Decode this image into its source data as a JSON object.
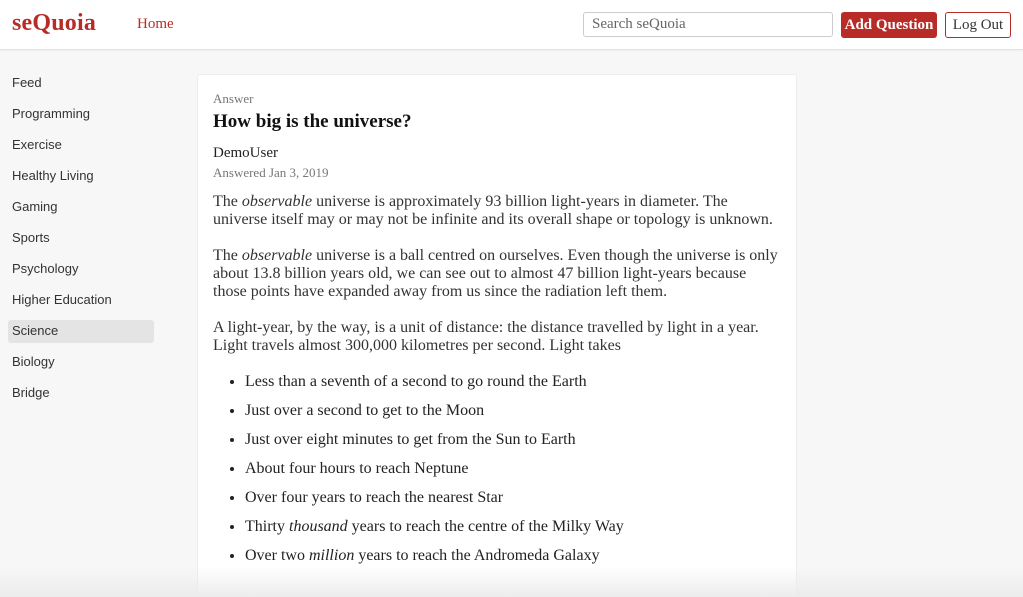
{
  "header": {
    "logo": "seQuoia",
    "home_link": "Home",
    "search_placeholder": "Search seQuoia",
    "add_question_label": "Add Question",
    "logout_label": "Log Out"
  },
  "sidebar": {
    "items": [
      {
        "label": "Feed",
        "active": false
      },
      {
        "label": "Programming",
        "active": false
      },
      {
        "label": "Exercise",
        "active": false
      },
      {
        "label": "Healthy Living",
        "active": false
      },
      {
        "label": "Gaming",
        "active": false
      },
      {
        "label": "Sports",
        "active": false
      },
      {
        "label": "Psychology",
        "active": false
      },
      {
        "label": "Higher Education",
        "active": false
      },
      {
        "label": "Science",
        "active": true
      },
      {
        "label": "Biology",
        "active": false
      },
      {
        "label": "Bridge",
        "active": false
      }
    ]
  },
  "answer": {
    "label": "Answer",
    "question_title": "How big is the universe?",
    "author": "DemoUser",
    "answered_date": "Answered Jan 3, 2019",
    "paragraphs": [
      {
        "before": "The ",
        "em": "observable",
        "after": " universe is approximately 93 billion light-years in diameter. The universe itself may or may not be infinite and its overall shape or topology is unknown."
      },
      {
        "before": "The ",
        "em": "observable",
        "after": " universe is a ball centred on ourselves. Even though the universe is only about 13.8 billion years old, we can see out to almost 47 billion light-years because those points have expanded away from us since the radiation left them."
      },
      {
        "before": "A light-year, by the way, is a unit of distance: the distance travelled by light in a year. Light travels almost 300,000 kilometres per second. Light takes",
        "em": "",
        "after": ""
      }
    ],
    "bullets": [
      {
        "before": "Less than a seventh of a second to go round the Earth",
        "em": "",
        "after": ""
      },
      {
        "before": "Just over a second to get to the Moon",
        "em": "",
        "after": ""
      },
      {
        "before": "Just over eight minutes to get from the Sun to Earth",
        "em": "",
        "after": ""
      },
      {
        "before": "About four hours to reach Neptune",
        "em": "",
        "after": ""
      },
      {
        "before": "Over four years to reach the nearest Star",
        "em": "",
        "after": ""
      },
      {
        "before": "Thirty ",
        "em": "thousand",
        "after": " years to reach the centre of the Milky Way"
      },
      {
        "before": "Over two ",
        "em": "million",
        "after": " years to reach the Andromeda Galaxy"
      }
    ]
  },
  "colors": {
    "brand": "#b92b27",
    "active_sidebar_bg": "#e4e4e4"
  }
}
